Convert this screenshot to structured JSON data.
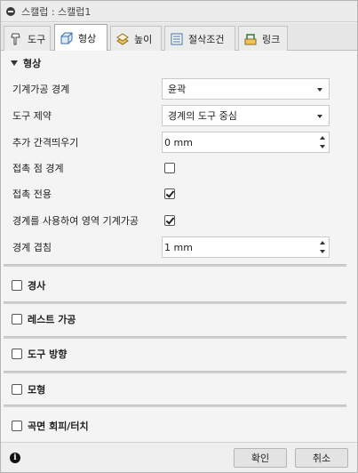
{
  "window": {
    "title": "스캘럽 : 스캘럽1"
  },
  "tabs": [
    {
      "label": "도구",
      "icon": "tool-icon"
    },
    {
      "label": "형상",
      "icon": "geometry-icon",
      "active": true
    },
    {
      "label": "높이",
      "icon": "heights-icon"
    },
    {
      "label": "절삭조건",
      "icon": "passes-icon"
    },
    {
      "label": "링크",
      "icon": "linking-icon"
    }
  ],
  "geometry_section": {
    "title": "형상",
    "rows": {
      "machining_boundary": {
        "label": "기계가공 경계",
        "value": "윤곽"
      },
      "tool_containment": {
        "label": "도구 제약",
        "value": "경계의 도구 중심"
      },
      "additional_offset": {
        "label": "추가 간격띄우기",
        "value": "0 mm"
      },
      "contact_point_boundary": {
        "label": "접촉 점 경계",
        "checked": false
      },
      "contact_only": {
        "label": "접촉 전용",
        "checked": true
      },
      "machine_using_boundary": {
        "label": "경계를 사용하여 영역 기계가공",
        "checked": true
      },
      "boundary_overlap": {
        "label": "경계 겹침",
        "value": "1 mm"
      }
    }
  },
  "collapsed_sections": [
    {
      "title": "경사",
      "checked": false
    },
    {
      "title": "레스트 가공",
      "checked": false
    },
    {
      "title": "도구 방향",
      "checked": false
    },
    {
      "title": "모형",
      "checked": false
    },
    {
      "title": "곡면 회피/터치",
      "checked": false
    }
  ],
  "footer": {
    "info_icon": "i",
    "ok_label": "확인",
    "cancel_label": "취소"
  }
}
